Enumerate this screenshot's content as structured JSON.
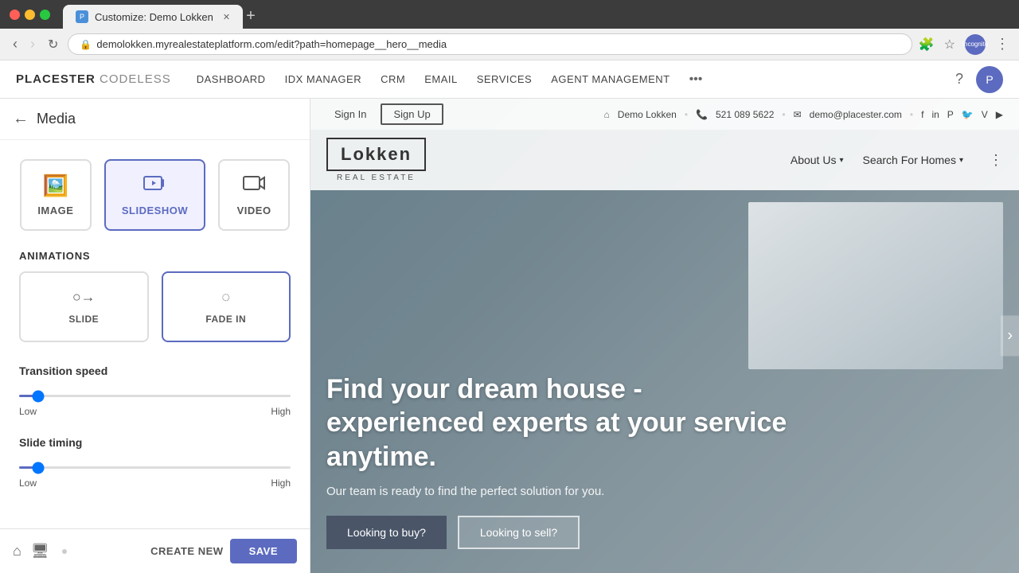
{
  "browser": {
    "tab_title": "Customize: Demo Lokken",
    "url": "demolokken.myrealestateplatform.com/edit?path=homepage__hero__media",
    "incognito_label": "Incognito"
  },
  "app_nav": {
    "brand": "PLACESTER",
    "brand_suffix": "CODELESS",
    "links": [
      "DASHBOARD",
      "IDX MANAGER",
      "CRM",
      "EMAIL",
      "SERVICES",
      "AGENT MANAGEMENT"
    ],
    "more_label": "•••"
  },
  "sidebar": {
    "title": "Media",
    "media_types": [
      {
        "label": "IMAGE",
        "icon": "🖼"
      },
      {
        "label": "SLIDESHOW",
        "icon": "🖼"
      },
      {
        "label": "VIDEO",
        "icon": "▶"
      }
    ],
    "active_media": 1,
    "animations_label": "ANIMATIONS",
    "animation_types": [
      {
        "label": "SLIDE",
        "icon": "○→"
      },
      {
        "label": "FADE IN",
        "icon": "◌"
      }
    ],
    "active_animation": 1,
    "transition_speed_label": "Transition speed",
    "slide_timing_label": "Slide timing",
    "low_label": "Low",
    "high_label": "High",
    "create_label": "CREATE NEW",
    "save_label": "SAVE"
  },
  "site": {
    "signin_label": "Sign In",
    "signup_label": "Sign Up",
    "agent_name": "Demo Lokken",
    "phone": "521 089 5622",
    "email": "demo@placester.com",
    "logo": "Lokken",
    "logo_sub": "REAL ESTATE",
    "nav_links": [
      "About Us",
      "Search For Homes"
    ],
    "hero_title": "Find your dream house - experienced experts at your service anytime.",
    "hero_subtitle": "Our team is ready to find the perfect solution for you.",
    "btn_buy": "Looking to buy?",
    "btn_sell": "Looking to sell?"
  }
}
